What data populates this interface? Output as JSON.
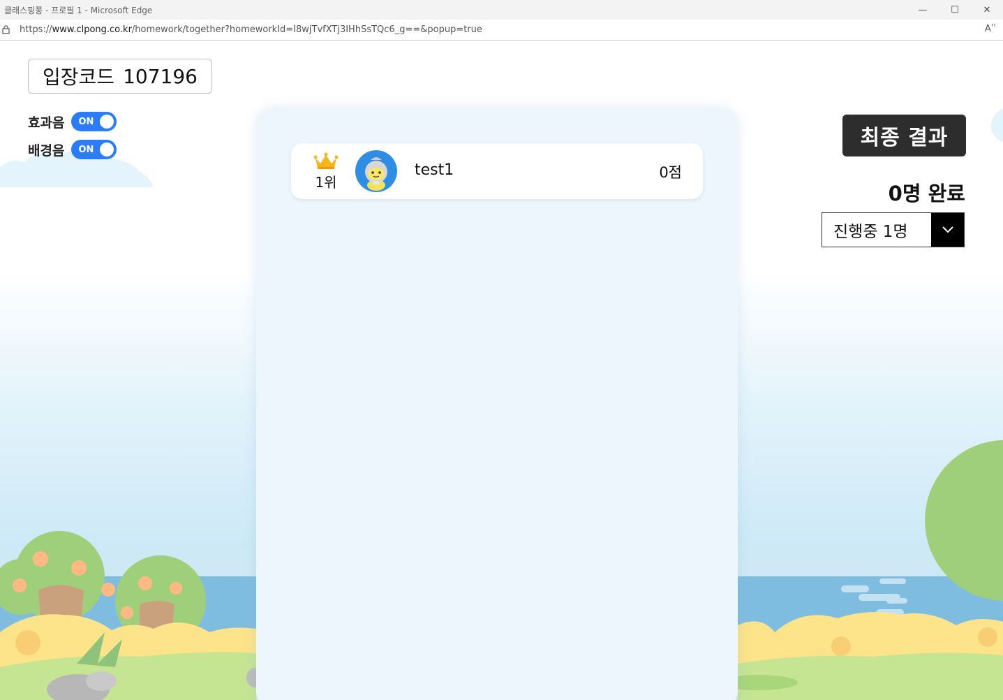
{
  "window": {
    "title": "클래스핑퐁 - 프로필 1 - Microsoft Edge",
    "url_prefix": "https://",
    "url_domain": "www.clpong.co.kr",
    "url_path": "/homework/together?homeworkId=I8wjTvfXTj3IHhSsTQc6_g==&popup=true",
    "read_aloud": "Aʹʹ",
    "minimize": "—",
    "maximize": "☐",
    "close": "✕"
  },
  "entry": {
    "label": "입장코드",
    "code": "107196"
  },
  "toggles": [
    {
      "label": "효과음",
      "state": "ON"
    },
    {
      "label": "배경음",
      "state": "ON"
    }
  ],
  "leaderboard": [
    {
      "rank": "1위",
      "name": "test1",
      "score": "0점"
    }
  ],
  "final_result_label": "최종 결과",
  "completed_label": "0명 완료",
  "status_select": {
    "selected": "진행중 1명"
  },
  "colors": {
    "toggle_on": "#2b7cf6",
    "final_button": "#2d2d2d",
    "board_bg": "#eef6fd"
  }
}
